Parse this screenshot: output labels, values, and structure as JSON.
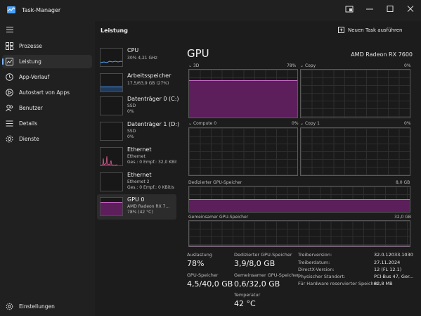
{
  "window": {
    "title": "Task-Manager"
  },
  "nav": {
    "items": [
      {
        "label": "Prozesse",
        "icon": "processes-icon"
      },
      {
        "label": "Leistung",
        "icon": "performance-icon"
      },
      {
        "label": "App-Verlauf",
        "icon": "history-icon"
      },
      {
        "label": "Autostart von Apps",
        "icon": "startup-icon"
      },
      {
        "label": "Benutzer",
        "icon": "users-icon"
      },
      {
        "label": "Details",
        "icon": "details-icon"
      },
      {
        "label": "Dienste",
        "icon": "services-icon"
      }
    ],
    "settings": "Einstellungen"
  },
  "header": {
    "section": "Leistung",
    "new_task": "Neuen Task ausführen"
  },
  "devices": [
    {
      "name": "CPU",
      "lines": [
        "30% 4,21 GHz"
      ],
      "level": 0.3
    },
    {
      "name": "Arbeitsspeicher",
      "lines": [
        "17,5/63,9 GB (27%)"
      ],
      "level": 0.27
    },
    {
      "name": "Datenträger 0 (C:)",
      "lines": [
        "SSD",
        "0%"
      ],
      "level": 0
    },
    {
      "name": "Datenträger 1 (D:)",
      "lines": [
        "SSD",
        "0%"
      ],
      "level": 0
    },
    {
      "name": "Ethernet",
      "lines": [
        "Ethernet",
        "Ges.: 0 Empf.: 32,0 KBit/s"
      ],
      "level": 0.15
    },
    {
      "name": "Ethernet",
      "lines": [
        "Ethernet 2",
        "Ges.: 0 Empf.: 0 KBit/s"
      ],
      "level": 0
    },
    {
      "name": "GPU 0",
      "lines": [
        "AMD Radeon RX 7...",
        "78% (42 °C)"
      ],
      "level": 0.78
    }
  ],
  "gpu": {
    "title": "GPU",
    "model": "AMD Radeon RX 7600",
    "engines": [
      {
        "name": "3D",
        "percent": "78%",
        "level": 0.78
      },
      {
        "name": "Copy",
        "percent": "0%",
        "level": 0
      },
      {
        "name": "Compute 0",
        "percent": "0%",
        "level": 0
      },
      {
        "name": "Copy 1",
        "percent": "0%",
        "level": 0
      }
    ],
    "dedicated": {
      "label": "Dedizierter GPU-Speicher",
      "max": "8,0 GB",
      "level": 0.49
    },
    "shared": {
      "label": "Gemeinsamer GPU-Speicher",
      "max": "32,0 GB",
      "level": 0.02
    },
    "stats": {
      "utilization_label": "Auslastung",
      "utilization": "78%",
      "dedicated_label": "Dedizierter GPU-Speicher",
      "dedicated_value": "3,9/8,0 GB",
      "memory_label": "GPU-Speicher",
      "memory_value": "4,5/40,0 GB",
      "shared_label": "Gemeinsamer GPU-Speicher",
      "shared_value": "0,6/32,0 GB",
      "temp_label": "Temperatur",
      "temp_value": "42 °C"
    },
    "info": [
      {
        "key": "Treiberversion:",
        "value": "32.0.12033.1030"
      },
      {
        "key": "Treiberdatum:",
        "value": "27.11.2024"
      },
      {
        "key": "DirectX-Version:",
        "value": "12 (FL 12.1)"
      },
      {
        "key": "Physischer Standort:",
        "value": "PCI-Bus 47, Ger..."
      },
      {
        "key": "Für Hardware reservierter Speicher:",
        "value": "82,8 MB"
      }
    ]
  },
  "colors": {
    "accent": "#7ab4ff",
    "gpu_fill": "#5d1f5c",
    "gpu_line": "#c86ac8",
    "cpu_line": "#4aa3ff",
    "net_line": "#e06a9a"
  }
}
